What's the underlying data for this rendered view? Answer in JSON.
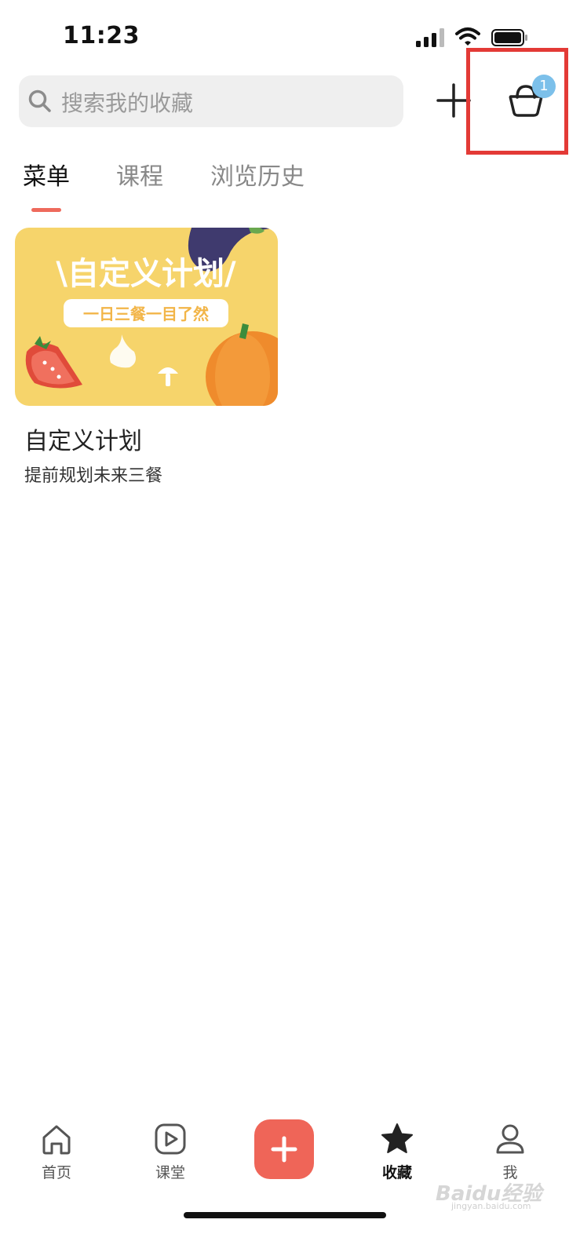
{
  "status_bar": {
    "time": "11:23"
  },
  "search": {
    "placeholder": "搜索我的收藏"
  },
  "header": {
    "cart_badge": "1"
  },
  "tabs": [
    {
      "label": "菜单",
      "active": true
    },
    {
      "label": "课程",
      "active": false
    },
    {
      "label": "浏览历史",
      "active": false
    }
  ],
  "card": {
    "banner_title": "\\自定义计划/",
    "banner_subtitle": "一日三餐一目了然",
    "title": "自定义计划",
    "subtitle": "提前规划未来三餐"
  },
  "nav": [
    {
      "label": "首页",
      "icon": "home-icon"
    },
    {
      "label": "课堂",
      "icon": "play-icon"
    },
    {
      "label": "",
      "icon": "plus-icon"
    },
    {
      "label": "收藏",
      "icon": "star-icon",
      "active": true
    },
    {
      "label": "我",
      "icon": "person-icon"
    }
  ],
  "watermark": {
    "text": "Baidu经验",
    "sub": "jingyan.baidu.com"
  },
  "colors": {
    "accent": "#ef6558",
    "badge": "#7cc0ea",
    "banner": "#f6d46b",
    "highlight": "#e33a36"
  }
}
